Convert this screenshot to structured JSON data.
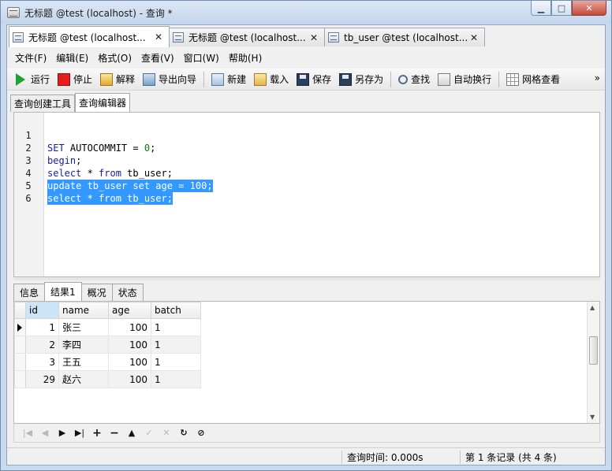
{
  "window": {
    "title": "无标题 @test (localhost) - 查询 *"
  },
  "doc_tabs": [
    {
      "label": "无标题 @test (localhost...",
      "active": true
    },
    {
      "label": "无标题 @test (localhost...",
      "active": false
    },
    {
      "label": "tb_user @test (localhost...",
      "active": false
    }
  ],
  "menu": [
    "文件(F)",
    "编辑(E)",
    "格式(O)",
    "查看(V)",
    "窗口(W)",
    "帮助(H)"
  ],
  "toolbar": {
    "run": "运行",
    "stop": "停止",
    "explain": "解释",
    "export": "导出向导",
    "new": "新建",
    "load": "载入",
    "save": "保存",
    "saveas": "另存为",
    "find": "查找",
    "wrap": "自动换行",
    "grid": "网格查看"
  },
  "sub_tabs": [
    "查询创建工具",
    "查询编辑器"
  ],
  "editor": {
    "lines": [
      {
        "n": "1",
        "text": "SET AUTOCOMMIT = 0;"
      },
      {
        "n": "2",
        "text": "begin;"
      },
      {
        "n": "3",
        "text": "select * from tb_user;"
      },
      {
        "n": "4",
        "text": "update tb_user set age = 100;"
      },
      {
        "n": "5",
        "text": "select * from tb_user;"
      },
      {
        "n": "6",
        "text": ""
      }
    ],
    "selected_lines": [
      4,
      5
    ]
  },
  "result_tabs": [
    "信息",
    "结果1",
    "概况",
    "状态"
  ],
  "result": {
    "columns": [
      "id",
      "name",
      "age",
      "batch"
    ],
    "rows": [
      [
        "1",
        "张三",
        "100",
        "1"
      ],
      [
        "2",
        "李四",
        "100",
        "1"
      ],
      [
        "3",
        "王五",
        "100",
        "1"
      ],
      [
        "29",
        "赵六",
        "100",
        "1"
      ]
    ]
  },
  "nav_icons": [
    "first-icon",
    "prev-icon",
    "next-icon",
    "last-icon",
    "add-icon",
    "delete-icon",
    "up-icon",
    "check-icon",
    "cancel-icon",
    "refresh-icon",
    "stop-icon"
  ],
  "status": {
    "query_time": "查询时间: 0.000s",
    "record": "第 1 条记录 (共 4 条)"
  }
}
